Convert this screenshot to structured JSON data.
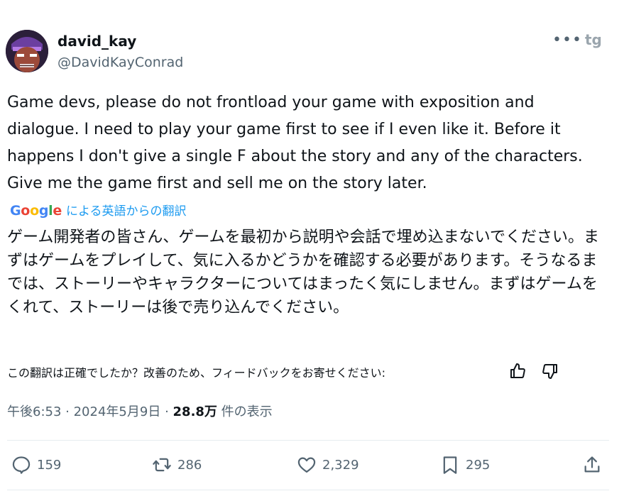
{
  "author": {
    "display_name": "david_kay",
    "handle": "@DavidKayConrad"
  },
  "icons": {
    "more": "more-horizontal-icon",
    "brand": "tg-logo-icon"
  },
  "tweet": {
    "text": "Game devs, please do not frontload your game with exposition and dialogue. I need to play your game first to see if I even like it. Before it happens I don't give a single F about the story and any of the characters. Give me the game first and sell me on the story later."
  },
  "translation": {
    "provider": "Google",
    "link_label": "による英語からの翻訳",
    "text": "ゲーム開発者の皆さん、ゲームを最初から説明や会話で埋め込まないでください。まずはゲームをプレイして、気に入るかどうかを確認する必要があります。そうなるまでは、ストーリーやキャラクターについてはまったく気にしません。まずはゲームをくれて、ストーリーは後で売り込んでください。",
    "feedback_prompt": "この翻訳は正確でしたか？改善のため、フィードバックをお寄せください:"
  },
  "meta": {
    "time": "午後6:53",
    "date": "2024年5月9日",
    "views_count": "28.8万",
    "views_label": "件の表示"
  },
  "actions": {
    "replies": "159",
    "reposts": "286",
    "likes": "2,329",
    "bookmarks": "295"
  },
  "colors": {
    "link": "#1d9bf0",
    "muted": "#536471",
    "text": "#0f1419"
  }
}
